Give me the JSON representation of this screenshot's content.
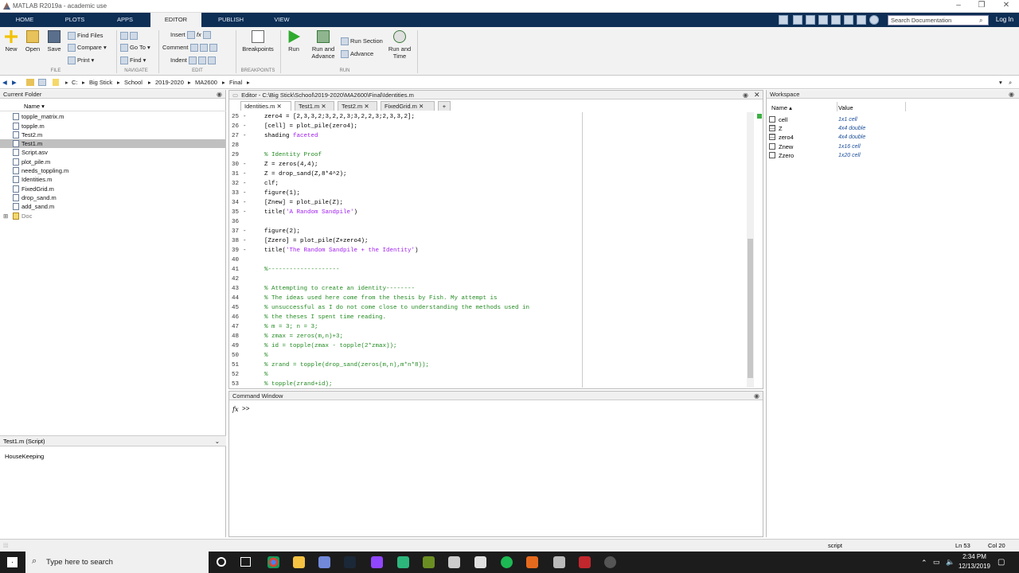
{
  "window": {
    "title": "MATLAB R2019a - academic use",
    "min": "–",
    "max": "❐",
    "close": "✕"
  },
  "ribbon_tabs": [
    "HOME",
    "PLOTS",
    "APPS",
    "EDITOR",
    "PUBLISH",
    "VIEW"
  ],
  "search": {
    "placeholder": "Search Documentation",
    "icon": "search-icon"
  },
  "login": "Log In",
  "file_group": {
    "label": "FILE",
    "new": "New",
    "open": "Open",
    "save": "Save",
    "find_files": "Find Files",
    "compare": "Compare",
    "print": "Print"
  },
  "navigate_group": {
    "label": "NAVIGATE",
    "goto": "Go To",
    "find": "Find"
  },
  "edit_group": {
    "label": "EDIT",
    "insert": "Insert",
    "comment": "Comment",
    "indent": "Indent",
    "fx": "fx"
  },
  "breakpoints_group": {
    "label": "BREAKPOINTS",
    "breakpoints": "Breakpoints"
  },
  "run_group": {
    "label": "RUN",
    "run": "Run",
    "run_advance": "Run and",
    "run_advance2": "Advance",
    "run_section": "Run Section",
    "advance": "Advance",
    "run_time": "Run and",
    "run_time2": "Time"
  },
  "breadcrumb": [
    "C:",
    "Big Stick",
    "School",
    "2019-2020",
    "MA2600",
    "Final"
  ],
  "current_folder": {
    "title": "Current Folder",
    "col_name": "Name ▾",
    "files": [
      {
        "name": "topple_matrix.m",
        "selected": false
      },
      {
        "name": "topple.m",
        "selected": false
      },
      {
        "name": "Test2.m",
        "selected": false
      },
      {
        "name": "Test1.m",
        "selected": true
      },
      {
        "name": "Script.asv",
        "selected": false
      },
      {
        "name": "plot_pile.m",
        "selected": false
      },
      {
        "name": "needs_toppling.m",
        "selected": false
      },
      {
        "name": "Identities.m",
        "selected": false
      },
      {
        "name": "FixedGrid.m",
        "selected": false
      },
      {
        "name": "drop_sand.m",
        "selected": false
      },
      {
        "name": "add_sand.m",
        "selected": false
      }
    ],
    "folder": "Doc"
  },
  "details": {
    "title": "Test1.m  (Script)",
    "body": "HouseKeeping"
  },
  "editor": {
    "title": "Editor - C:\\Big Stick\\School\\2019-2020\\MA2600\\Final\\Identities.m",
    "tabs": [
      "Identities.m",
      "Test1.m",
      "Test2.m",
      "FixedGrid.m"
    ],
    "lines": [
      {
        "n": "25",
        "dash": "-",
        "text": "zero4 = [2,3,3,2;3,2,2,3;3,2,2,3;2,3,3,2];",
        "kind": "code"
      },
      {
        "n": "26",
        "dash": "-",
        "text": "[cell] = plot_pile(zero4);",
        "kind": "code"
      },
      {
        "n": "27",
        "dash": "-",
        "text": "shading ",
        "extra": "faceted",
        "kind": "mixed"
      },
      {
        "n": "28",
        "dash": "",
        "text": "",
        "kind": "code"
      },
      {
        "n": "29",
        "dash": "",
        "text": "% Identity Proof",
        "kind": "comment"
      },
      {
        "n": "30",
        "dash": "-",
        "text": "Z = zeros(4,4);",
        "kind": "code"
      },
      {
        "n": "31",
        "dash": "-",
        "text": "Z = drop_sand(Z,8*4^2);",
        "kind": "code"
      },
      {
        "n": "32",
        "dash": "-",
        "text": "clf;",
        "kind": "code"
      },
      {
        "n": "33",
        "dash": "-",
        "text": "figure(1);",
        "kind": "code"
      },
      {
        "n": "34",
        "dash": "-",
        "text": "[Znew] = plot_pile(Z);",
        "kind": "code"
      },
      {
        "n": "35",
        "dash": "-",
        "text": "title(",
        "extra": "'A Random Sandpile'",
        "tail": ")",
        "kind": "mixed"
      },
      {
        "n": "36",
        "dash": "",
        "text": "",
        "kind": "code"
      },
      {
        "n": "37",
        "dash": "-",
        "text": "figure(2);",
        "kind": "code"
      },
      {
        "n": "38",
        "dash": "-",
        "text": "[Zzero] = plot_pile(Z+zero4);",
        "kind": "code"
      },
      {
        "n": "39",
        "dash": "-",
        "text": "title(",
        "extra": "'The Random Sandpile + the Identity'",
        "tail": ")",
        "kind": "mixed"
      },
      {
        "n": "40",
        "dash": "",
        "text": "",
        "kind": "code"
      },
      {
        "n": "41",
        "dash": "",
        "text": "%--------------------",
        "kind": "comment"
      },
      {
        "n": "42",
        "dash": "",
        "text": "",
        "kind": "code"
      },
      {
        "n": "43",
        "dash": "",
        "text": "% Attempting to create an identity--------",
        "kind": "comment"
      },
      {
        "n": "44",
        "dash": "",
        "text": "% The ideas used here come from the thesis by Fish. My attempt is",
        "kind": "comment"
      },
      {
        "n": "45",
        "dash": "",
        "text": "% unsuccessful as I do not come close to understanding the methods used in",
        "kind": "comment"
      },
      {
        "n": "46",
        "dash": "",
        "text": "% the theses I spent time reading.",
        "kind": "comment"
      },
      {
        "n": "47",
        "dash": "",
        "text": "% m = 3; n = 3;",
        "kind": "comment"
      },
      {
        "n": "48",
        "dash": "",
        "text": "% zmax = zeros(m,n)+3;",
        "kind": "comment"
      },
      {
        "n": "49",
        "dash": "",
        "text": "% id = topple(zmax - topple(2*zmax));",
        "kind": "comment"
      },
      {
        "n": "50",
        "dash": "",
        "text": "%",
        "kind": "comment"
      },
      {
        "n": "51",
        "dash": "",
        "text": "% zrand = topple(drop_sand(zeros(m,n),m*n*8));",
        "kind": "comment"
      },
      {
        "n": "52",
        "dash": "",
        "text": "%",
        "kind": "comment"
      },
      {
        "n": "53",
        "dash": "",
        "text": "% topple(zrand+id);",
        "kind": "comment"
      }
    ]
  },
  "command_window": {
    "title": "Command Window",
    "fx": "fx",
    "prompt": ">>"
  },
  "workspace": {
    "title": "Workspace",
    "col_name": "Name ▴",
    "col_value": "Value",
    "vars": [
      {
        "name": "cell",
        "value": "1x1 cell"
      },
      {
        "name": "Z",
        "value": "4x4 double"
      },
      {
        "name": "zero4",
        "value": "4x4 double"
      },
      {
        "name": "Znew",
        "value": "1x16 cell"
      },
      {
        "name": "Zzero",
        "value": "1x20 cell"
      }
    ]
  },
  "status": {
    "mode": "script",
    "ln": "Ln  53",
    "col": "Col  20"
  },
  "taskbar": {
    "search": "Type here to search",
    "time": "2:34 PM",
    "date": "12/13/2019"
  },
  "colors": {
    "ribbon_dark": "#0d2e55",
    "comment": "#228b22",
    "string": "#a020f0",
    "keyword": "#0000ff"
  }
}
